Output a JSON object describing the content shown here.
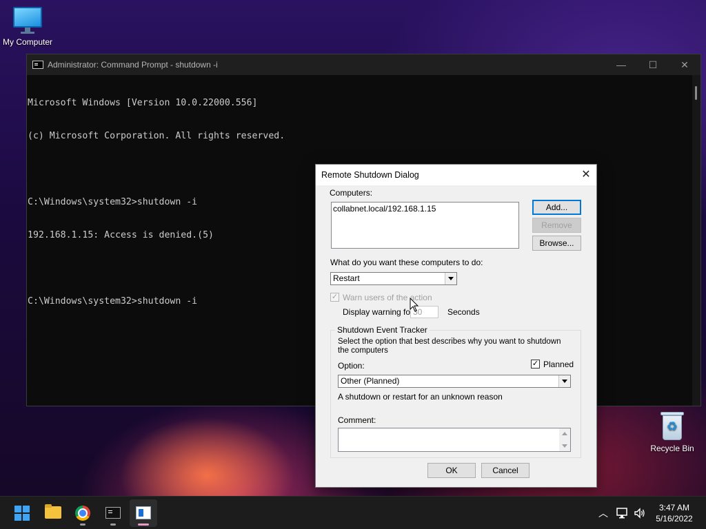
{
  "desktop": {
    "my_computer_label": "My Computer",
    "recycle_bin_label": "Recycle Bin"
  },
  "cmd": {
    "title": "Administrator: Command Prompt - shutdown  -i",
    "minimize_glyph": "—",
    "maximize_glyph": "☐",
    "close_glyph": "✕",
    "lines": [
      "Microsoft Windows [Version 10.0.22000.556]",
      "(c) Microsoft Corporation. All rights reserved.",
      "",
      "C:\\Windows\\system32>shutdown -i",
      "192.168.1.15: Access is denied.(5)",
      "",
      "C:\\Windows\\system32>shutdown -i"
    ]
  },
  "dialog": {
    "title": "Remote Shutdown Dialog",
    "close_glyph": "✕",
    "computers_label": "Computers:",
    "computers": [
      "collabnet.local/192.168.1.15"
    ],
    "add_button": "Add...",
    "remove_button": "Remove",
    "browse_button": "Browse...",
    "action_label": "What do you want these computers to do:",
    "action_value": "Restart",
    "warn_label": "Warn users of the action",
    "warn_checked_glyph": "✓",
    "display_warning_label": "Display warning for",
    "warning_seconds": "30",
    "seconds_label": "Seconds",
    "tracker_title": "Shutdown Event Tracker",
    "tracker_desc": "Select the option that best describes why you want to shutdown the computers",
    "option_label": "Option:",
    "planned_label": "Planned",
    "planned_checked_glyph": "✓",
    "option_value": "Other (Planned)",
    "reason_text": "A shutdown or restart for an unknown reason",
    "comment_label": "Comment:",
    "comment_value": "",
    "ok_button": "OK",
    "cancel_button": "Cancel"
  },
  "taskbar": {
    "clock_time": "3:47 AM",
    "clock_date": "5/16/2022",
    "tray_chevron": "︿",
    "active_app": "remote-shutdown-dialog",
    "accent_color": "#e89dc8"
  }
}
